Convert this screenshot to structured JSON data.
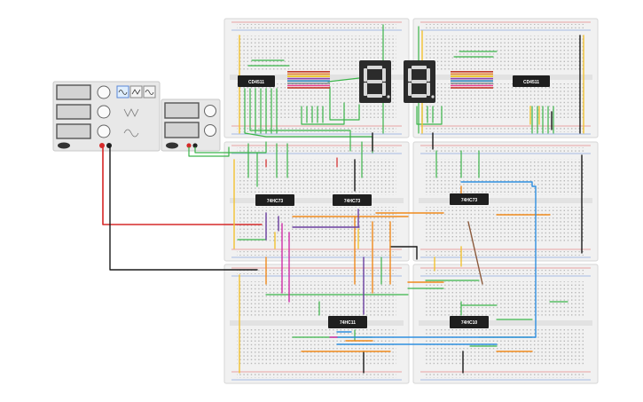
{
  "chips": {
    "decoder_left": "CD4511",
    "decoder_right": "CD4511",
    "flipflop_1": "74HC73",
    "flipflop_2": "74HC73",
    "flipflop_3": "74HC73",
    "gate_and": "74HC11",
    "gate_nand": "74HC10"
  },
  "colors": {
    "board": "#f1f1f1",
    "board_edge": "#d6d6d6",
    "rail_red": "#e05555",
    "rail_blue": "#5a86d6",
    "chip": "#1f1f1f",
    "display": "#2b2b2b",
    "segment": "#d8d8d8",
    "wire_green": "#3bb54a",
    "wire_red": "#d62a2a",
    "wire_black": "#1a1a1a",
    "wire_yellow": "#f2c230",
    "wire_orange": "#f08a1c",
    "wire_blue": "#2f8fe0",
    "wire_purple": "#6b3fa0",
    "wire_magenta": "#d12ea8",
    "wire_brown": "#8b5a3c",
    "instrument": "#e6e6e6"
  },
  "icons": {
    "function_generator": "sine-wave-icon",
    "power_supply": "power-supply-icon",
    "display": "seven-segment-display-icon"
  }
}
